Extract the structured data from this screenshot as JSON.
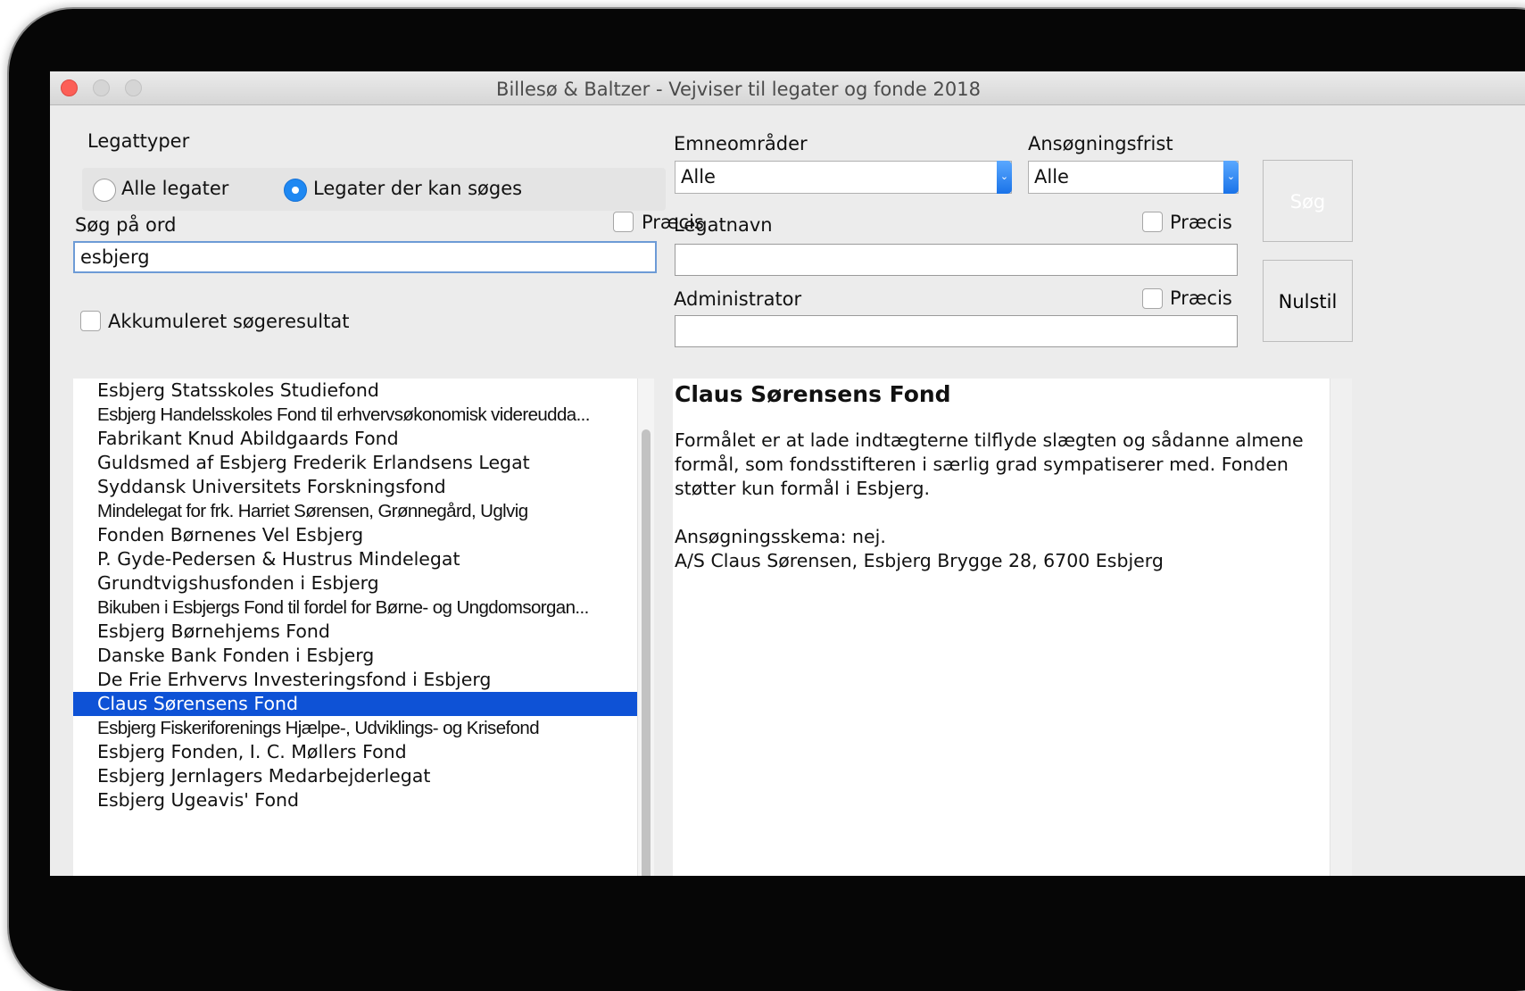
{
  "window": {
    "title": "Billesø & Baltzer - Vejviser til legater og fonde 2018"
  },
  "legattyper": {
    "label": "Legattyper",
    "options": [
      "Alle legater",
      "Legater der kan søges"
    ],
    "selected": "Legater der kan søges"
  },
  "search_word": {
    "label": "Søg på ord",
    "precise_label": "Præcis",
    "precise_checked": false,
    "value": "esbjerg"
  },
  "accumulated": {
    "label": "Akkumuleret søgeresultat",
    "checked": false
  },
  "emneomraader": {
    "label": "Emneområder",
    "value": "Alle"
  },
  "ansoegningsfrist": {
    "label": "Ansøgningsfrist",
    "value": "Alle"
  },
  "legatnavn": {
    "label": "Legatnavn",
    "precise_label": "Præcis",
    "precise_checked": false,
    "value": ""
  },
  "administrator": {
    "label": "Administrator",
    "precise_label": "Præcis",
    "precise_checked": false,
    "value": ""
  },
  "buttons": {
    "search": "Søg",
    "reset": "Nulstil"
  },
  "results": [
    "Esbjerg Statsskoles Studiefond",
    "Esbjerg Handelsskoles Fond til erhvervsøkonomisk videreudda...",
    "Fabrikant Knud Abildgaards Fond",
    "Guldsmed af Esbjerg Frederik Erlandsens Legat",
    "Syddansk Universitets Forskningsfond",
    "Mindelegat for frk. Harriet Sørensen, Grønnegård, Uglvig",
    "Fonden Børnenes Vel Esbjerg",
    "P. Gyde-Pedersen & Hustrus Mindelegat",
    "Grundtvigshusfonden i Esbjerg",
    "Bikuben i Esbjergs Fond til fordel for Børne- og Ungdomsorgan...",
    "Esbjerg Børnehjems Fond",
    "Danske Bank Fonden i Esbjerg",
    "De Frie Erhvervs Investeringsfond i Esbjerg",
    "Claus Sørensens Fond",
    "Esbjerg Fiskeriforenings Hjælpe-, Udviklings- og Krisefond",
    "Esbjerg Fonden, I. C. Møllers Fond",
    "Esbjerg Jernlagers Medarbejderlegat",
    "Esbjerg Ugeavis' Fond"
  ],
  "selected_result": "Claus Sørensens Fond",
  "detail": {
    "title": "Claus Sørensens Fond",
    "purpose_lines": [
      "Formålet er at lade indtægterne tilflyde slægten og sådanne almene",
      "formål, som fondsstifteren i særlig grad sympatiserer med. Fonden",
      "støtter kun formål i Esbjerg."
    ],
    "info_lines": [
      "Ansøgningsskema: nej.",
      "A/S Claus Sørensen, Esbjerg Brygge 28, 6700 Esbjerg"
    ]
  }
}
